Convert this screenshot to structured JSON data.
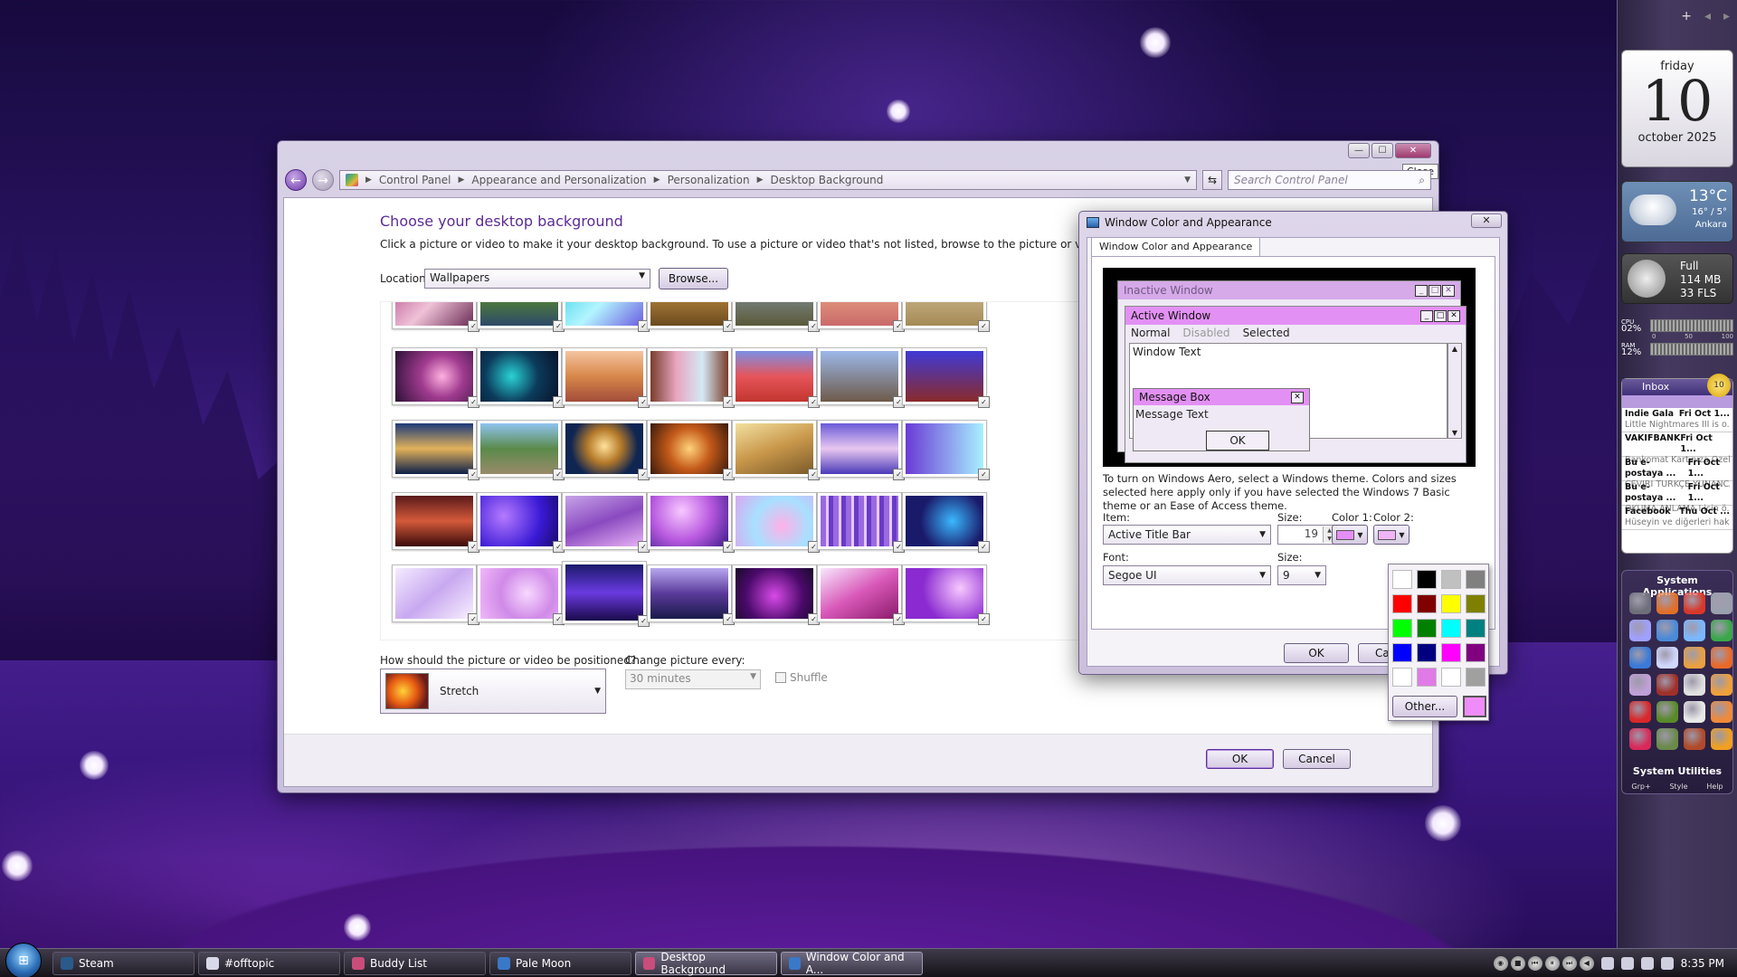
{
  "main_window": {
    "close_tooltip": "Close",
    "breadcrumb": [
      "Control Panel",
      "Appearance and Personalization",
      "Personalization",
      "Desktop Background"
    ],
    "search_placeholder": "Search Control Panel",
    "heading": "Choose your desktop background",
    "description": "Click a picture or video to make it your desktop background. To use a picture or video that's not listed, browse to the picture or video and double cli",
    "location_label": "Location",
    "location_value": "Wallpapers",
    "browse_label": "Browse...",
    "position_label": "How should the picture or video be positioned?",
    "position_value": "Stretch",
    "change_label": "Change picture every:",
    "change_value": "30 minutes",
    "shuffle_label": "Shuffle",
    "ok_label": "OK",
    "cancel_label": "Cancel"
  },
  "dialog": {
    "title": "Window Color and Appearance",
    "tab": "Window Color and Appearance",
    "preview": {
      "inactive_title": "Inactive Window",
      "active_title": "Active Window",
      "menu_normal": "Normal",
      "menu_disabled": "Disabled",
      "menu_selected": "Selected",
      "window_text": "Window Text",
      "message_box_title": "Message Box",
      "message_text": "Message Text",
      "ok": "OK"
    },
    "aero_text": "To turn on Windows Aero, select a Windows theme.  Colors and sizes selected here apply only if you have selected the Windows 7 Basic theme or an Ease of Access theme.",
    "item_label": "Item:",
    "item_value": "Active Title Bar",
    "size_label": "Size:",
    "item_size": "19",
    "color1_label": "Color 1:",
    "color2_label": "Color 2:",
    "font_label": "Font:",
    "font_value": "Segoe UI",
    "font_size_label": "Size:",
    "font_size": "9",
    "ok_label": "OK",
    "cancel_label": "Ca",
    "close_label": "✕",
    "color1": "#e58ef5",
    "color2": "#f0b4f7",
    "palette_other": "Other...",
    "palette_current": "#f08cf9",
    "palette_colors": [
      "#ffffff",
      "#000000",
      "#c0c0c0",
      "#808080",
      "#ff0000",
      "#800000",
      "#ffff00",
      "#808000",
      "#00ff00",
      "#008000",
      "#00ffff",
      "#008080",
      "#0000ff",
      "#000080",
      "#ff00ff",
      "#800080",
      "#ffffff",
      "#e07ae6",
      "#ffffff",
      "#a0a0a0"
    ]
  },
  "sidebar": {
    "calendar_day": "friday",
    "calendar_num": "10",
    "calendar_month": "october 2025",
    "weather_temp": "13°C",
    "weather_hl": "16° / 5°",
    "weather_city": "Ankara",
    "recycle_status": "Full",
    "recycle_size": "114 MB",
    "recycle_files": "33 FLS",
    "cpu_label": "CPU",
    "cpu_value": "02%",
    "ram_label": "RAM",
    "ram_value": "12%",
    "meter_scale": [
      "0",
      "50",
      "100"
    ],
    "inbox_label": "Inbox",
    "inbox_count": "10",
    "mails": [
      {
        "from": "Indie Gala",
        "date": "Fri Oct 1...",
        "subject": "Little Nightmares III is o..."
      },
      {
        "from": "VAKIFBANK",
        "date": "Fri Oct 1...",
        "subject": "Bankomat Kartınıza Özel..."
      },
      {
        "from": "Bu e-postaya ...",
        "date": "Fri Oct 1...",
        "subject": "ÇEVİRİ TÜRKÇE YUNANCA..."
      },
      {
        "from": "Bu e-postaya ...",
        "date": "Fri Oct 1...",
        "subject": "OKUMA ANLAMA I için ö..."
      },
      {
        "from": "Facebook",
        "date": "Thu Oct ...",
        "subject": "Hüseyin ve diğerleri hak..."
      }
    ],
    "apps_title": "System Applications",
    "utilities_title": "System Utilities",
    "util_links": [
      "Grp+",
      "Style",
      "Help"
    ]
  },
  "taskbar": {
    "tasks": [
      {
        "label": "Steam",
        "color": "#2a5a8a"
      },
      {
        "label": "#offtopic",
        "color": "#d8d8e8"
      },
      {
        "label": "Buddy List",
        "color": "#c94d7a"
      },
      {
        "label": "Pale Moon",
        "color": "#3a78c8"
      },
      {
        "label": "Desktop Background",
        "color": "#c94d7a"
      },
      {
        "label": "Window Color and A...",
        "color": "#3a78c8"
      }
    ],
    "clock": "8:35 PM"
  }
}
